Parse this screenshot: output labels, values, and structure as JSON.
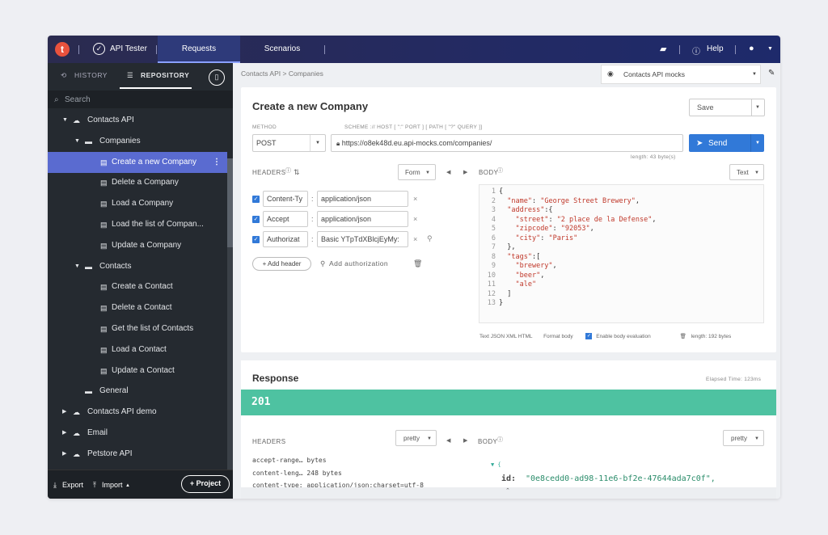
{
  "topbar": {
    "logo": "t",
    "product": "API Tester",
    "tabs": [
      {
        "label": "Requests"
      },
      {
        "label": "Scenarios"
      }
    ],
    "help": "Help"
  },
  "sidebar": {
    "tab_history": "HISTORY",
    "tab_repository": "REPOSITORY",
    "search_placeholder": "Search",
    "tree": [
      {
        "label": "Contacts API",
        "level": 0,
        "icon": "folder-cloud-icon",
        "expanded": true
      },
      {
        "label": "Companies",
        "level": 1,
        "icon": "folder-icon",
        "expanded": true
      },
      {
        "label": "Create a new Company",
        "level": 2,
        "icon": "request-icon",
        "selected": true
      },
      {
        "label": "Delete a Company",
        "level": 2,
        "icon": "request-icon"
      },
      {
        "label": "Load a Company",
        "level": 2,
        "icon": "request-icon"
      },
      {
        "label": "Load the list of Compan...",
        "level": 2,
        "icon": "request-icon"
      },
      {
        "label": "Update a Company",
        "level": 2,
        "icon": "request-icon"
      },
      {
        "label": "Contacts",
        "level": 1,
        "icon": "folder-icon",
        "expanded": true
      },
      {
        "label": "Create a Contact",
        "level": 2,
        "icon": "request-icon"
      },
      {
        "label": "Delete a Contact",
        "level": 2,
        "icon": "request-icon"
      },
      {
        "label": "Get the list of Contacts",
        "level": 2,
        "icon": "request-icon"
      },
      {
        "label": "Load a Contact",
        "level": 2,
        "icon": "request-icon"
      },
      {
        "label": "Update a Contact",
        "level": 2,
        "icon": "request-icon"
      },
      {
        "label": "General",
        "level": 1,
        "icon": "folder-icon"
      },
      {
        "label": "Contacts API demo",
        "level": 0,
        "icon": "folder-cloud-icon"
      },
      {
        "label": "Email",
        "level": 0,
        "icon": "folder-cloud-icon"
      },
      {
        "label": "Petstore API",
        "level": 0,
        "icon": "folder-cloud-icon"
      }
    ],
    "export": "Export",
    "import": "Import",
    "project": "Project"
  },
  "breadcrumb": {
    "root": "Contacts API",
    "sep": ">",
    "current": "Companies"
  },
  "environment": {
    "selected": "Contacts API mocks"
  },
  "request": {
    "title": "Create a new Company",
    "save": "Save",
    "method_label": "METHOD",
    "method": "POST",
    "scheme_label": "SCHEME :// HOST [ \":\" PORT ] [ PATH [ \"?\" QUERY ]]",
    "url": "https://o8ek48d.eu.api-mocks.com/companies/",
    "url_length": "length: 43 byte(s)",
    "send": "Send",
    "headers_label": "HEADERS",
    "headers_mode": "Form",
    "headers": [
      {
        "name": "Content-Ty",
        "value": "application/json"
      },
      {
        "name": "Accept",
        "value": "application/json"
      },
      {
        "name": "Authorizat",
        "value": "Basic YTpTdXBlcjEyMy:"
      }
    ],
    "add_header": "Add header",
    "add_authorization": "Add authorization",
    "body_label": "BODY",
    "body_mode": "Text",
    "body_lines": [
      "{",
      "  \"name\": \"George Street Brewery\",",
      "  \"address\":{",
      "    \"street\": \"2 place de la Defense\",",
      "    \"zipcode\": \"92053\",",
      "    \"city\": \"Paris\"",
      "  },",
      "  \"tags\":[",
      "    \"brewery\",",
      "    \"beer\",",
      "    \"ale\"",
      "  ]",
      "}"
    ],
    "body_formats": "Text  JSON  XML  HTML",
    "format_body": "Format body",
    "enable_eval": "Enable body evaluation",
    "body_length": "length: 192 bytes"
  },
  "response": {
    "title": "Response",
    "elapsed": "Elapsed Time: 123ms",
    "status": "201",
    "headers_label": "HEADERS",
    "headers_mode": "pretty",
    "body_label": "BODY",
    "body_mode": "pretty",
    "headers": [
      "accept-range… bytes",
      "content-leng… 248 bytes",
      "content-type: application/json;charset=utf-8"
    ],
    "body_id_key": "id:",
    "body_id_value": "\"0e8cedd0-ad98-11e6-bf2e-47644ada7c0f\","
  },
  "colors": {
    "accent": "#3179d8",
    "success": "#4ec2a1",
    "selected": "#5a6bd0",
    "topbar": "#232a63"
  }
}
